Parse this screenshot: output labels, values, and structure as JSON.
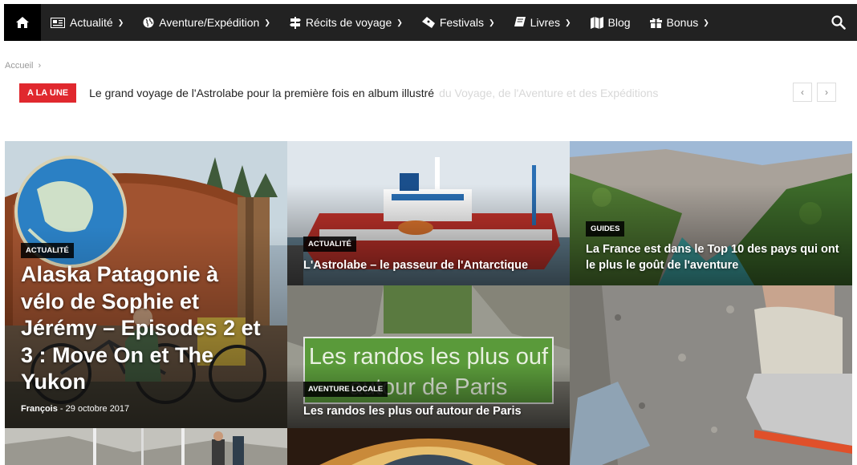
{
  "nav": {
    "home_icon": "home-icon",
    "items": [
      {
        "label": "Actualité",
        "icon": "newspaper-icon",
        "has_dropdown": true
      },
      {
        "label": "Aventure/Expédition",
        "icon": "globe-icon",
        "has_dropdown": true
      },
      {
        "label": "Récits de voyage",
        "icon": "signpost-icon",
        "has_dropdown": true
      },
      {
        "label": "Festivals",
        "icon": "ticket-icon",
        "has_dropdown": true
      },
      {
        "label": "Livres",
        "icon": "book-icon",
        "has_dropdown": true
      },
      {
        "label": "Blog",
        "icon": "map-icon",
        "has_dropdown": false
      },
      {
        "label": "Bonus",
        "icon": "gift-icon",
        "has_dropdown": true
      }
    ],
    "search_icon": "search-icon"
  },
  "breadcrumb": {
    "home": "Accueil",
    "separator": "›"
  },
  "ticker": {
    "tag": "A LA UNE",
    "headline": "Le grand voyage de l'Astrolabe pour la première fois en album illustré",
    "faded": "du Voyage, de l'Aventure et des Expéditions"
  },
  "tiles": [
    {
      "category": "Actualité",
      "title": "Alaska Patagonie à vélo de Sophie et Jérémy – Episodes 2 et 3 : Move On et The Yukon",
      "author": "François",
      "date": "29 octobre 2017"
    },
    {
      "category": "Actualité",
      "title": "L'Astrolabe – le passeur de l'Antarctique"
    },
    {
      "category": "Guides",
      "title": "La France est dans le Top 10 des pays qui ont le plus le goût de l'aventure"
    },
    {
      "category": "Aventure locale",
      "title": "Les randos les plus ouf autour de Paris",
      "sign": "Les randos les plus ouf autour de Paris"
    }
  ],
  "colors": {
    "nav_bg": "#222222",
    "accent": "#e0282e"
  }
}
